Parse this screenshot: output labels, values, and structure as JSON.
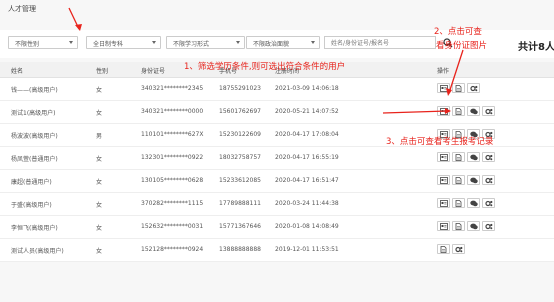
{
  "breadcrumb": "人才管理",
  "filters": {
    "gender": "不限性别",
    "education": "全日制专科",
    "study_mode": "不限学习形式",
    "political": "不限政治面貌",
    "search_placeholder": "姓名/身份证号/报名号",
    "total": "共计8人"
  },
  "table": {
    "headers": [
      "姓名",
      "性别",
      "身份证号",
      "手机号",
      "注册时间",
      "操作"
    ],
    "rows": [
      {
        "name": "钱——(高级用户)",
        "gender": "女",
        "id": "340321********2345",
        "phone": "18755291023",
        "time": "2021-03-09 14:06:18"
      },
      {
        "name": "测试1(高级用户)",
        "gender": "女",
        "id": "340321********0000",
        "phone": "15601762697",
        "time": "2020-05-21 14:07:52"
      },
      {
        "name": "杨波波(高级用户)",
        "gender": "男",
        "id": "110101********627X",
        "phone": "15230122609",
        "time": "2020-04-17 17:08:04"
      },
      {
        "name": "杨凤萱(普通用户)",
        "gender": "女",
        "id": "132301********0922",
        "phone": "18032758757",
        "time": "2020-04-17 16:55:19"
      },
      {
        "name": "康超(普通用户)",
        "gender": "女",
        "id": "130105********0628",
        "phone": "15233612085",
        "time": "2020-04-17 16:51:47"
      },
      {
        "name": "于盛(高级用户)",
        "gender": "女",
        "id": "370282********1115",
        "phone": "17789888111",
        "time": "2020-03-24 11:44:38"
      },
      {
        "name": "李恒飞(高级用户)",
        "gender": "女",
        "id": "152632********0031",
        "phone": "15771367646",
        "time": "2020-01-08 14:08:49"
      },
      {
        "name": "测试人员(高级用户)",
        "gender": "女",
        "id": "152128********0924",
        "phone": "13888888888",
        "time": "2019-12-01 11:53:51"
      }
    ]
  },
  "annotations": {
    "a1": "1、筛选学历条件,则可选出符合条件的用户",
    "a2_line1": "2、点击可查",
    "a2_line2": "看身份证图片",
    "a3": "3、点击可查看考生报考记录"
  },
  "colors": {
    "annotation": "#e8231c"
  }
}
